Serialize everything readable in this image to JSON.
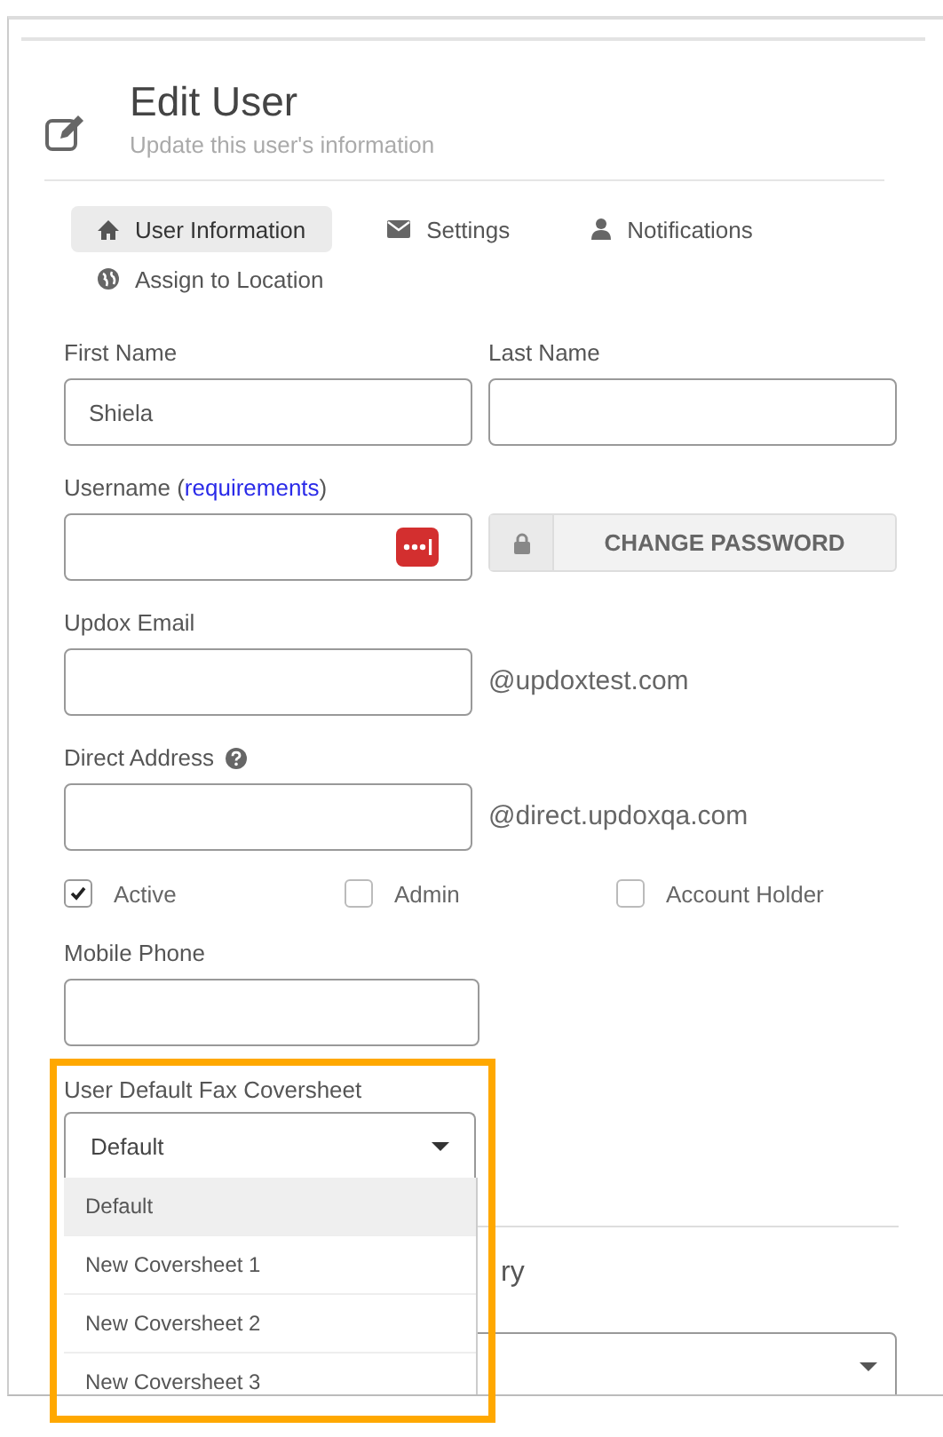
{
  "header": {
    "title": "Edit User",
    "subtitle": "Update this user's information"
  },
  "tabs": [
    {
      "label": "User Information",
      "selected": true
    },
    {
      "label": "Settings",
      "selected": false
    },
    {
      "label": "Notifications",
      "selected": false
    },
    {
      "label": "Assign to Location",
      "selected": false
    }
  ],
  "form": {
    "first_name": {
      "label": "First Name",
      "value": "Shiela"
    },
    "last_name": {
      "label": "Last Name"
    },
    "username": {
      "label": "Username (",
      "link": "requirements",
      "label_end": ")"
    },
    "change_password_button": "CHANGE PASSWORD",
    "updox_email": {
      "label": "Updox Email",
      "suffix": "@updoxtest.com"
    },
    "direct_address": {
      "label": "Direct Address",
      "suffix": "@direct.updoxqa.com"
    },
    "checkboxes": [
      {
        "label": "Active",
        "checked": true
      },
      {
        "label": "Admin",
        "checked": false
      },
      {
        "label": "Account Holder",
        "checked": false
      }
    ],
    "mobile_phone": {
      "label": "Mobile Phone"
    },
    "fax_coversheet": {
      "label": "User Default Fax Coversheet",
      "value": "Default",
      "highlighted": true,
      "options": [
        {
          "label": "Default",
          "selected": true
        },
        {
          "label": "New Coversheet 1",
          "selected": false
        },
        {
          "label": "New Coversheet 2",
          "selected": false
        },
        {
          "label": "New Coversheet 3",
          "selected": false
        }
      ]
    },
    "partly_hidden_heading": "ry"
  }
}
